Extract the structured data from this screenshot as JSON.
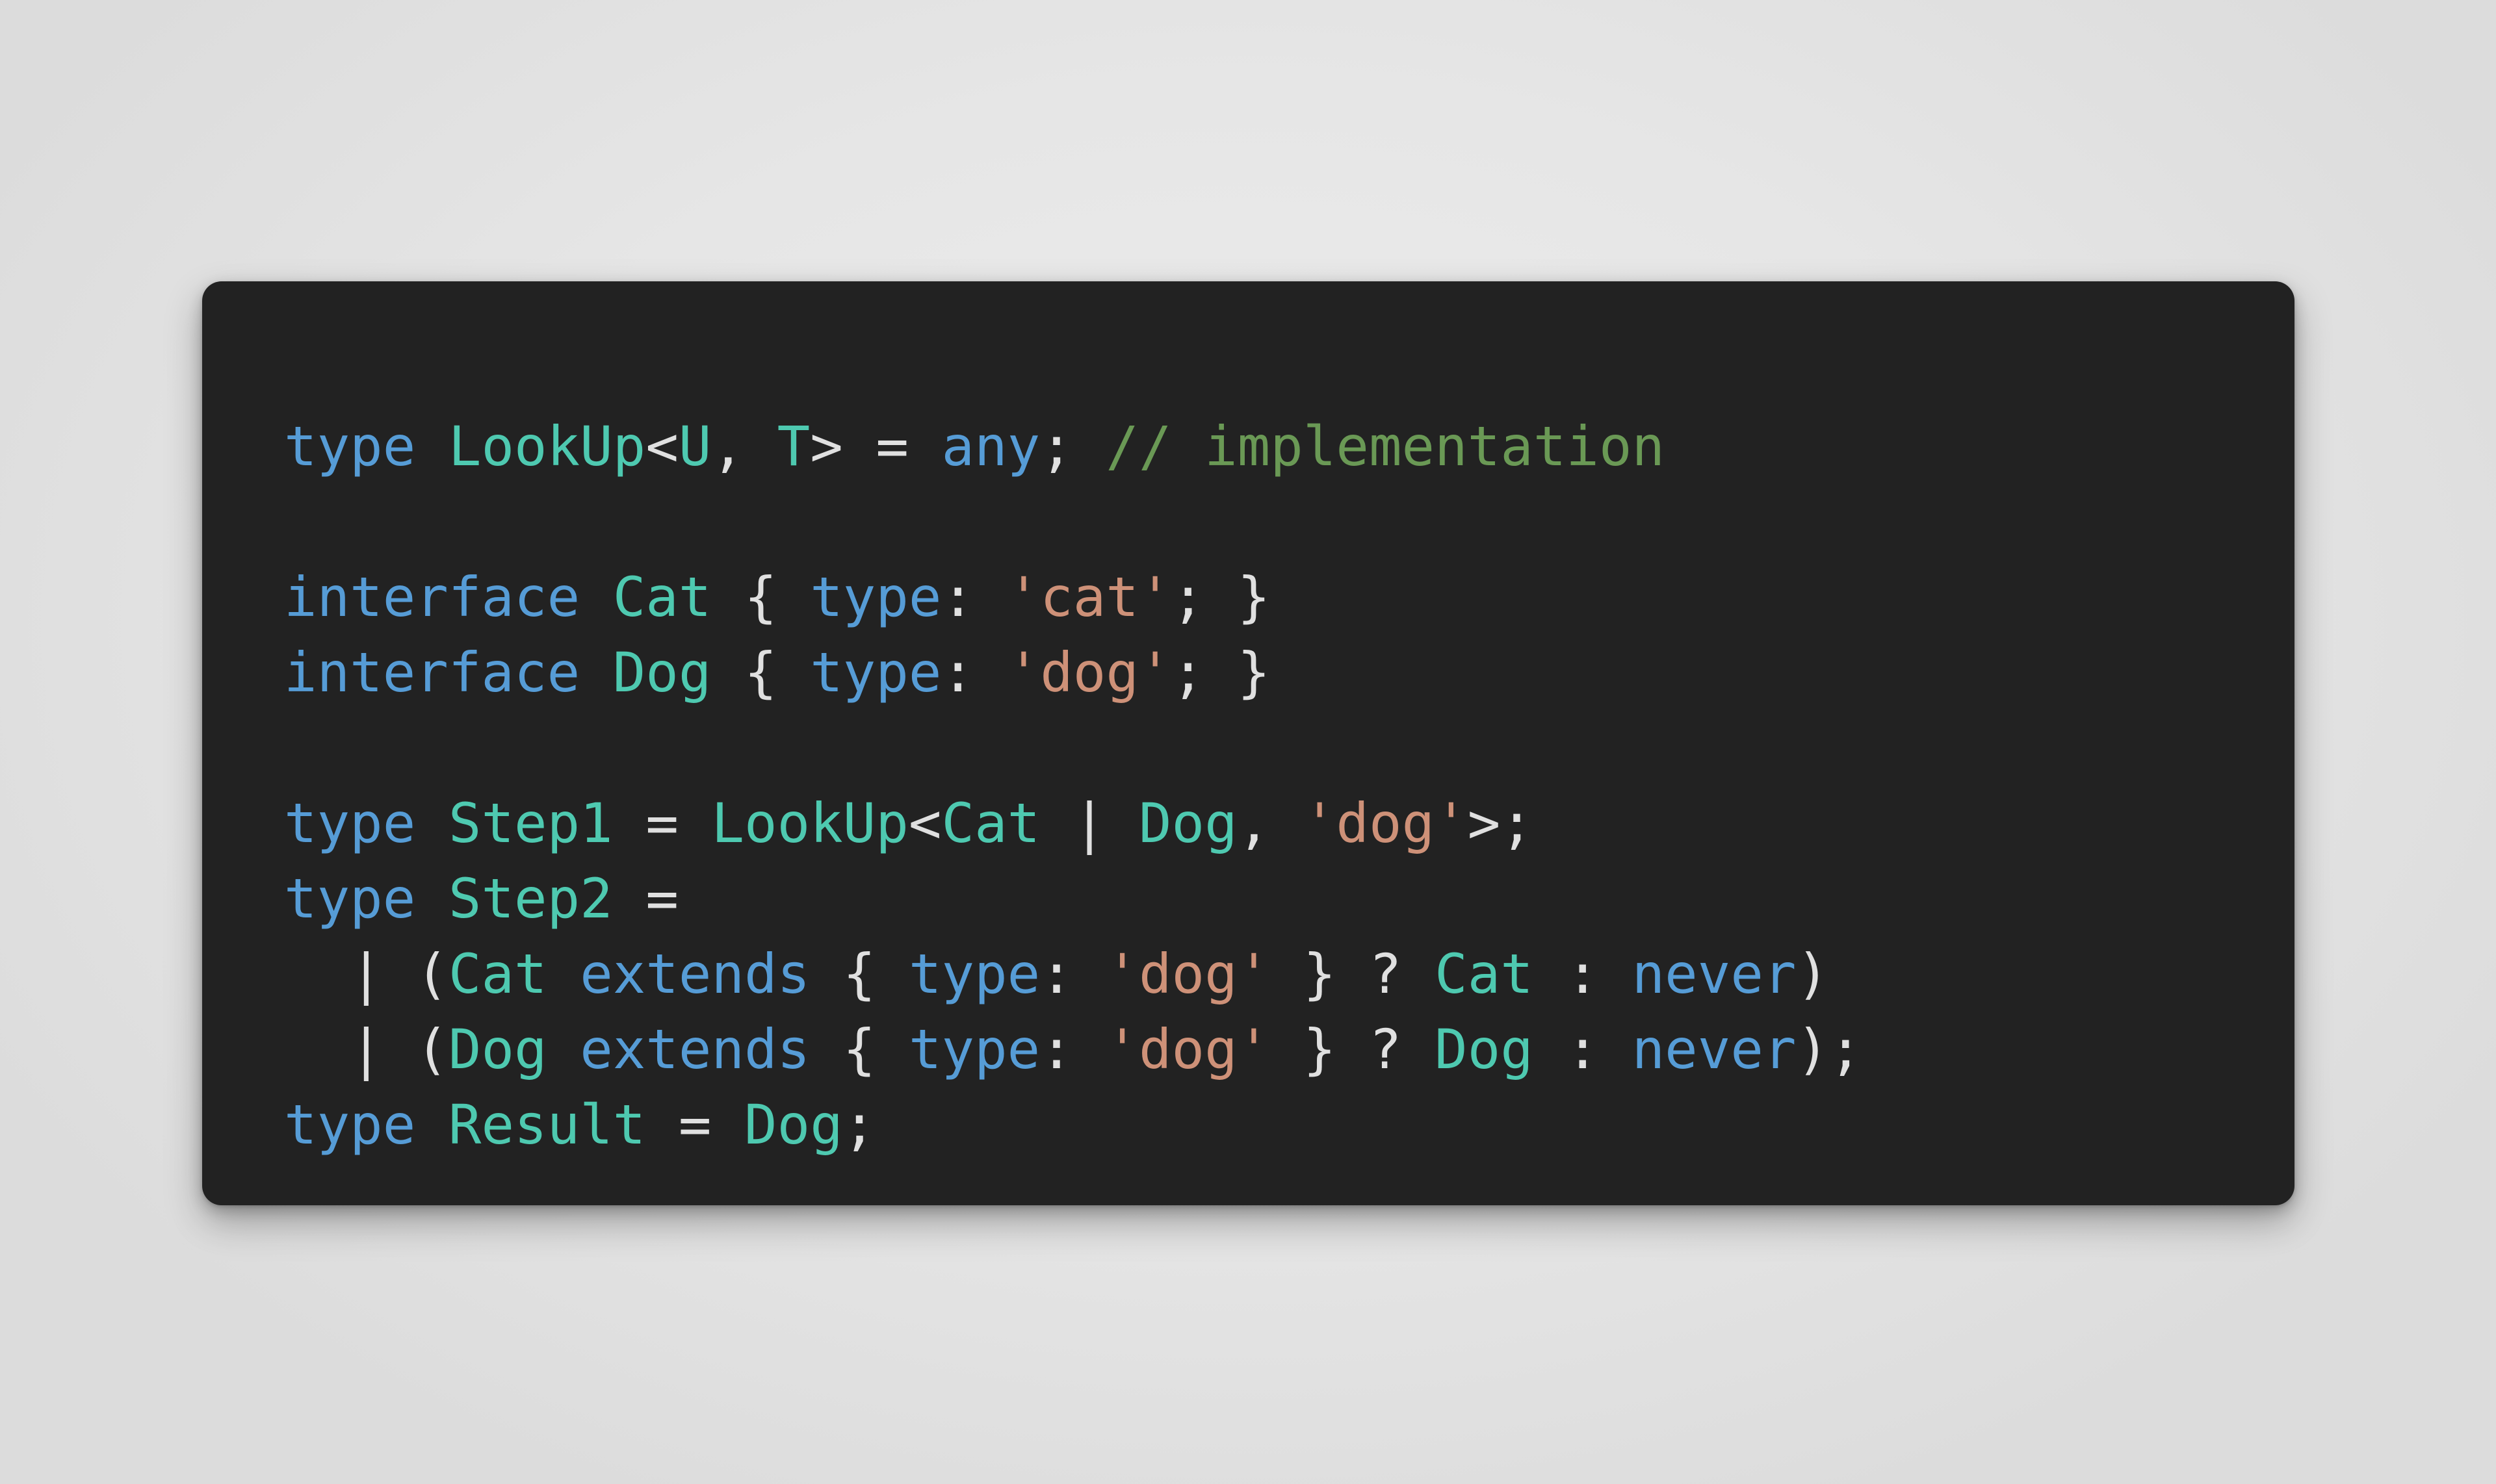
{
  "page": {
    "background_color": "#e9e9e9",
    "card_background_color": "#222222"
  },
  "theme": {
    "keyword_color": "#569cd6",
    "type_color": "#4ec9b0",
    "string_color": "#ce9178",
    "comment_color": "#6a9955",
    "punctuation_color": "#e0e0e0"
  },
  "code": {
    "language": "typescript",
    "plain_text": "type LookUp<U, T> = any; // implementation\n\ninterface Cat { type: 'cat'; }\ninterface Dog { type: 'dog'; }\n\ntype Step1 = LookUp<Cat | Dog, 'dog'>;\ntype Step2 =\n  | (Cat extends { type: 'dog' } ? Cat : never)\n  | (Dog extends { type: 'dog' } ? Dog : never);\ntype Result = Dog;",
    "lines": [
      {
        "index": 1,
        "text": "type LookUp<U, T> = any; // implementation",
        "tokens": [
          {
            "t": "type",
            "c": "keyword"
          },
          {
            "t": " ",
            "c": "plain"
          },
          {
            "t": "LookUp",
            "c": "type"
          },
          {
            "t": "<",
            "c": "punct"
          },
          {
            "t": "U",
            "c": "type"
          },
          {
            "t": ", ",
            "c": "punct"
          },
          {
            "t": "T",
            "c": "type"
          },
          {
            "t": ">",
            "c": "punct"
          },
          {
            "t": " ",
            "c": "plain"
          },
          {
            "t": "=",
            "c": "punct"
          },
          {
            "t": " ",
            "c": "plain"
          },
          {
            "t": "any",
            "c": "keyword"
          },
          {
            "t": ";",
            "c": "punct"
          },
          {
            "t": " ",
            "c": "plain"
          },
          {
            "t": "// implementation",
            "c": "comment"
          }
        ]
      },
      {
        "index": 2,
        "text": "",
        "tokens": []
      },
      {
        "index": 3,
        "text": "interface Cat { type: 'cat'; }",
        "tokens": [
          {
            "t": "interface",
            "c": "keyword"
          },
          {
            "t": " ",
            "c": "plain"
          },
          {
            "t": "Cat",
            "c": "type"
          },
          {
            "t": " ",
            "c": "plain"
          },
          {
            "t": "{",
            "c": "punct"
          },
          {
            "t": " ",
            "c": "plain"
          },
          {
            "t": "type",
            "c": "keyword"
          },
          {
            "t": ":",
            "c": "punct"
          },
          {
            "t": " ",
            "c": "plain"
          },
          {
            "t": "'cat'",
            "c": "string"
          },
          {
            "t": ";",
            "c": "punct"
          },
          {
            "t": " ",
            "c": "plain"
          },
          {
            "t": "}",
            "c": "punct"
          }
        ]
      },
      {
        "index": 4,
        "text": "interface Dog { type: 'dog'; }",
        "tokens": [
          {
            "t": "interface",
            "c": "keyword"
          },
          {
            "t": " ",
            "c": "plain"
          },
          {
            "t": "Dog",
            "c": "type"
          },
          {
            "t": " ",
            "c": "plain"
          },
          {
            "t": "{",
            "c": "punct"
          },
          {
            "t": " ",
            "c": "plain"
          },
          {
            "t": "type",
            "c": "keyword"
          },
          {
            "t": ":",
            "c": "punct"
          },
          {
            "t": " ",
            "c": "plain"
          },
          {
            "t": "'dog'",
            "c": "string"
          },
          {
            "t": ";",
            "c": "punct"
          },
          {
            "t": " ",
            "c": "plain"
          },
          {
            "t": "}",
            "c": "punct"
          }
        ]
      },
      {
        "index": 5,
        "text": "",
        "tokens": []
      },
      {
        "index": 6,
        "text": "type Step1 = LookUp<Cat | Dog, 'dog'>;",
        "tokens": [
          {
            "t": "type",
            "c": "keyword"
          },
          {
            "t": " ",
            "c": "plain"
          },
          {
            "t": "Step1",
            "c": "type"
          },
          {
            "t": " ",
            "c": "plain"
          },
          {
            "t": "=",
            "c": "punct"
          },
          {
            "t": " ",
            "c": "plain"
          },
          {
            "t": "LookUp",
            "c": "type"
          },
          {
            "t": "<",
            "c": "punct"
          },
          {
            "t": "Cat",
            "c": "type"
          },
          {
            "t": " ",
            "c": "plain"
          },
          {
            "t": "|",
            "c": "punct"
          },
          {
            "t": " ",
            "c": "plain"
          },
          {
            "t": "Dog",
            "c": "type"
          },
          {
            "t": ", ",
            "c": "punct"
          },
          {
            "t": "'dog'",
            "c": "string"
          },
          {
            "t": ">",
            "c": "punct"
          },
          {
            "t": ";",
            "c": "punct"
          }
        ]
      },
      {
        "index": 7,
        "text": "type Step2 =",
        "tokens": [
          {
            "t": "type",
            "c": "keyword"
          },
          {
            "t": " ",
            "c": "plain"
          },
          {
            "t": "Step2",
            "c": "type"
          },
          {
            "t": " ",
            "c": "plain"
          },
          {
            "t": "=",
            "c": "punct"
          }
        ]
      },
      {
        "index": 8,
        "text": "  | (Cat extends { type: 'dog' } ? Cat : never)",
        "tokens": [
          {
            "t": "  ",
            "c": "plain"
          },
          {
            "t": "|",
            "c": "punct"
          },
          {
            "t": " ",
            "c": "plain"
          },
          {
            "t": "(",
            "c": "punct"
          },
          {
            "t": "Cat",
            "c": "type"
          },
          {
            "t": " ",
            "c": "plain"
          },
          {
            "t": "extends",
            "c": "keyword"
          },
          {
            "t": " ",
            "c": "plain"
          },
          {
            "t": "{",
            "c": "punct"
          },
          {
            "t": " ",
            "c": "plain"
          },
          {
            "t": "type",
            "c": "keyword"
          },
          {
            "t": ":",
            "c": "punct"
          },
          {
            "t": " ",
            "c": "plain"
          },
          {
            "t": "'dog'",
            "c": "string"
          },
          {
            "t": " ",
            "c": "plain"
          },
          {
            "t": "}",
            "c": "punct"
          },
          {
            "t": " ",
            "c": "plain"
          },
          {
            "t": "?",
            "c": "punct"
          },
          {
            "t": " ",
            "c": "plain"
          },
          {
            "t": "Cat",
            "c": "type"
          },
          {
            "t": " ",
            "c": "plain"
          },
          {
            "t": ":",
            "c": "punct"
          },
          {
            "t": " ",
            "c": "plain"
          },
          {
            "t": "never",
            "c": "keyword"
          },
          {
            "t": ")",
            "c": "punct"
          }
        ]
      },
      {
        "index": 9,
        "text": "  | (Dog extends { type: 'dog' } ? Dog : never);",
        "tokens": [
          {
            "t": "  ",
            "c": "plain"
          },
          {
            "t": "|",
            "c": "punct"
          },
          {
            "t": " ",
            "c": "plain"
          },
          {
            "t": "(",
            "c": "punct"
          },
          {
            "t": "Dog",
            "c": "type"
          },
          {
            "t": " ",
            "c": "plain"
          },
          {
            "t": "extends",
            "c": "keyword"
          },
          {
            "t": " ",
            "c": "plain"
          },
          {
            "t": "{",
            "c": "punct"
          },
          {
            "t": " ",
            "c": "plain"
          },
          {
            "t": "type",
            "c": "keyword"
          },
          {
            "t": ":",
            "c": "punct"
          },
          {
            "t": " ",
            "c": "plain"
          },
          {
            "t": "'dog'",
            "c": "string"
          },
          {
            "t": " ",
            "c": "plain"
          },
          {
            "t": "}",
            "c": "punct"
          },
          {
            "t": " ",
            "c": "plain"
          },
          {
            "t": "?",
            "c": "punct"
          },
          {
            "t": " ",
            "c": "plain"
          },
          {
            "t": "Dog",
            "c": "type"
          },
          {
            "t": " ",
            "c": "plain"
          },
          {
            "t": ":",
            "c": "punct"
          },
          {
            "t": " ",
            "c": "plain"
          },
          {
            "t": "never",
            "c": "keyword"
          },
          {
            "t": ")",
            "c": "punct"
          },
          {
            "t": ";",
            "c": "punct"
          }
        ]
      },
      {
        "index": 10,
        "text": "type Result = Dog;",
        "tokens": [
          {
            "t": "type",
            "c": "keyword"
          },
          {
            "t": " ",
            "c": "plain"
          },
          {
            "t": "Result",
            "c": "type"
          },
          {
            "t": " ",
            "c": "plain"
          },
          {
            "t": "=",
            "c": "punct"
          },
          {
            "t": " ",
            "c": "plain"
          },
          {
            "t": "Dog",
            "c": "type"
          },
          {
            "t": ";",
            "c": "punct"
          }
        ]
      }
    ]
  }
}
